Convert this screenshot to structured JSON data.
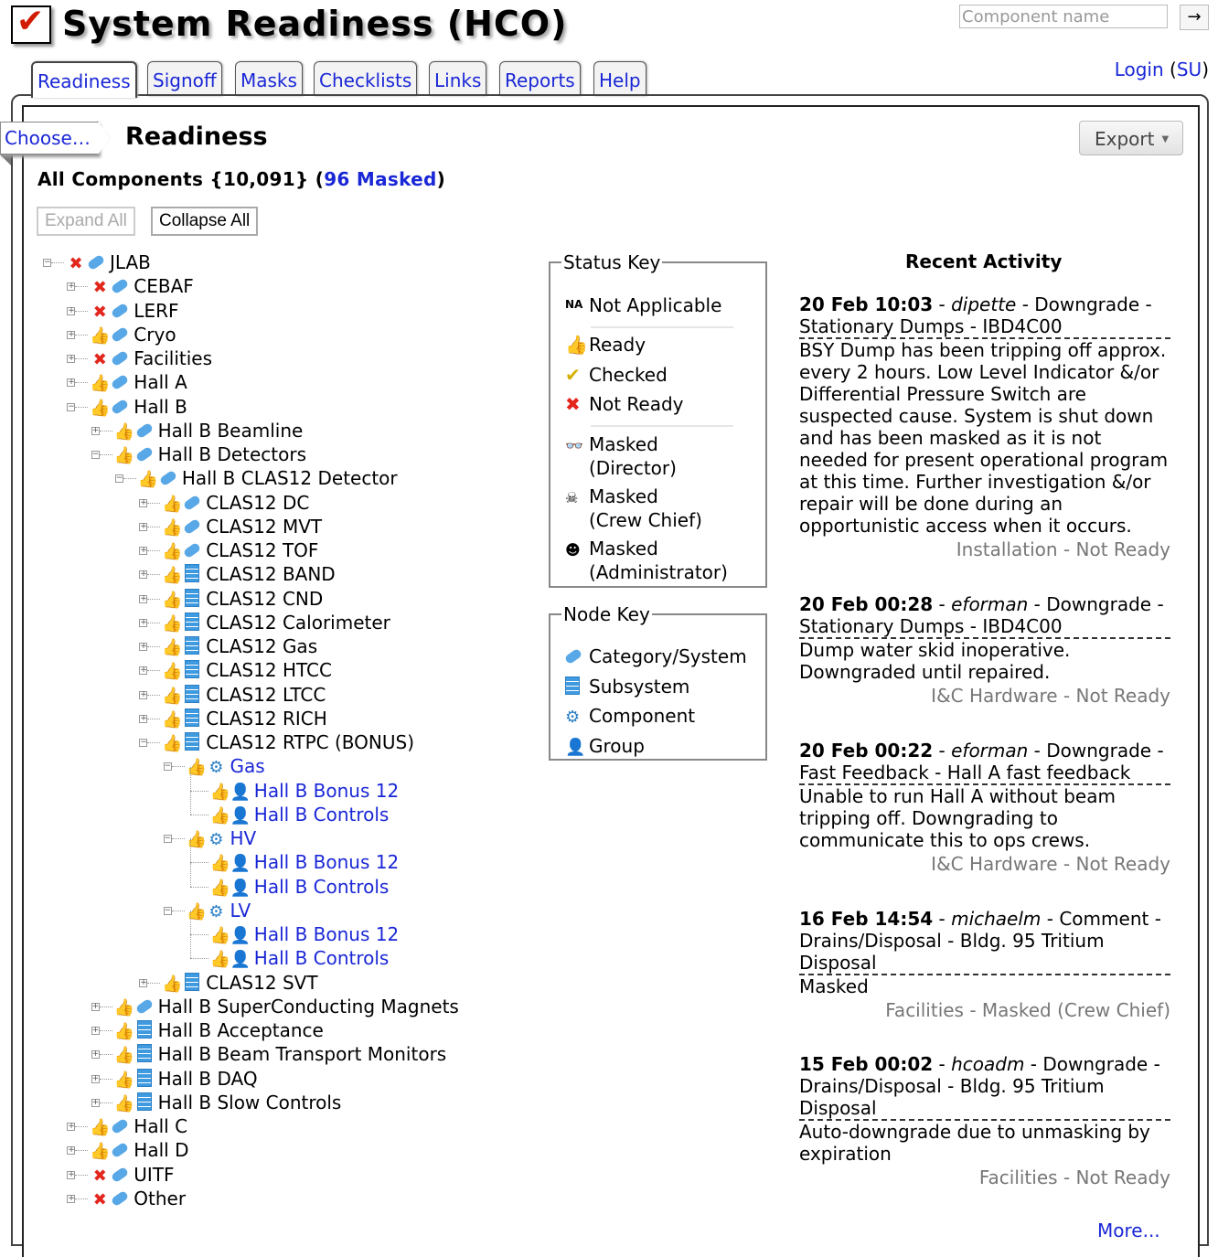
{
  "header": {
    "title": "System Readiness (HCO)",
    "search_placeholder": "Component name",
    "search_go": "→",
    "login_label": "Login",
    "su_label": "SU"
  },
  "tabs": [
    "Readiness",
    "Signoff",
    "Masks",
    "Checklists",
    "Links",
    "Reports",
    "Help"
  ],
  "page": {
    "choose_label": "Choose…",
    "title": "Readiness",
    "export_label": "Export",
    "summary_prefix": "All Components {10,091} (",
    "masked_link": "96 Masked",
    "summary_suffix": ")",
    "expand_all": "Expand All",
    "collapse_all": "Collapse All"
  },
  "tree": [
    {
      "label": "JLAB",
      "status": "notready",
      "type": "category",
      "depth": 0,
      "toggle": "-",
      "link": false
    },
    {
      "label": "CEBAF",
      "status": "notready",
      "type": "category",
      "depth": 1,
      "toggle": "+",
      "link": false
    },
    {
      "label": "LERF",
      "status": "notready",
      "type": "category",
      "depth": 1,
      "toggle": "+",
      "link": false
    },
    {
      "label": "Cryo",
      "status": "ready",
      "type": "category",
      "depth": 1,
      "toggle": "+",
      "link": false
    },
    {
      "label": "Facilities",
      "status": "notready",
      "type": "category",
      "depth": 1,
      "toggle": "+",
      "link": false
    },
    {
      "label": "Hall A",
      "status": "ready",
      "type": "category",
      "depth": 1,
      "toggle": "+",
      "link": false
    },
    {
      "label": "Hall B",
      "status": "ready",
      "type": "category",
      "depth": 1,
      "toggle": "-",
      "link": false
    },
    {
      "label": "Hall B Beamline",
      "status": "ready",
      "type": "category",
      "depth": 2,
      "toggle": "+",
      "link": false
    },
    {
      "label": "Hall B Detectors",
      "status": "ready",
      "type": "category",
      "depth": 2,
      "toggle": "-",
      "link": false
    },
    {
      "label": "Hall B CLAS12 Detector",
      "status": "ready",
      "type": "category",
      "depth": 3,
      "toggle": "-",
      "link": false
    },
    {
      "label": "CLAS12 DC",
      "status": "ready",
      "type": "category",
      "depth": 4,
      "toggle": "+",
      "link": false
    },
    {
      "label": "CLAS12 MVT",
      "status": "ready",
      "type": "category",
      "depth": 4,
      "toggle": "+",
      "link": false
    },
    {
      "label": "CLAS12 TOF",
      "status": "ready",
      "type": "category",
      "depth": 4,
      "toggle": "+",
      "link": false
    },
    {
      "label": "CLAS12 BAND",
      "status": "ready",
      "type": "subsystem",
      "depth": 4,
      "toggle": "+",
      "link": false
    },
    {
      "label": "CLAS12 CND",
      "status": "ready",
      "type": "subsystem",
      "depth": 4,
      "toggle": "+",
      "link": false
    },
    {
      "label": "CLAS12 Calorimeter",
      "status": "ready",
      "type": "subsystem",
      "depth": 4,
      "toggle": "+",
      "link": false
    },
    {
      "label": "CLAS12 Gas",
      "status": "ready",
      "type": "subsystem",
      "depth": 4,
      "toggle": "+",
      "link": false
    },
    {
      "label": "CLAS12 HTCC",
      "status": "ready",
      "type": "subsystem",
      "depth": 4,
      "toggle": "+",
      "link": false
    },
    {
      "label": "CLAS12 LTCC",
      "status": "ready",
      "type": "subsystem",
      "depth": 4,
      "toggle": "+",
      "link": false
    },
    {
      "label": "CLAS12 RICH",
      "status": "ready",
      "type": "subsystem",
      "depth": 4,
      "toggle": "+",
      "link": false
    },
    {
      "label": "CLAS12 RTPC (BONUS)",
      "status": "ready",
      "type": "subsystem",
      "depth": 4,
      "toggle": "-",
      "link": false
    },
    {
      "label": "Gas",
      "status": "ready",
      "type": "component",
      "depth": 5,
      "toggle": "-",
      "link": true
    },
    {
      "label": "Hall B Bonus 12",
      "status": "ready",
      "type": "group",
      "depth": 6,
      "toggle": "",
      "link": true
    },
    {
      "label": "Hall B Controls",
      "status": "ready",
      "type": "group",
      "depth": 6,
      "toggle": "",
      "link": true
    },
    {
      "label": "HV",
      "status": "ready",
      "type": "component",
      "depth": 5,
      "toggle": "-",
      "link": true
    },
    {
      "label": "Hall B Bonus 12",
      "status": "ready",
      "type": "group",
      "depth": 6,
      "toggle": "",
      "link": true
    },
    {
      "label": "Hall B Controls",
      "status": "ready",
      "type": "group",
      "depth": 6,
      "toggle": "",
      "link": true
    },
    {
      "label": "LV",
      "status": "ready",
      "type": "component",
      "depth": 5,
      "toggle": "-",
      "link": true
    },
    {
      "label": "Hall B Bonus 12",
      "status": "ready",
      "type": "group",
      "depth": 6,
      "toggle": "",
      "link": true
    },
    {
      "label": "Hall B Controls",
      "status": "ready",
      "type": "group",
      "depth": 6,
      "toggle": "",
      "link": true
    },
    {
      "label": "CLAS12 SVT",
      "status": "ready",
      "type": "subsystem",
      "depth": 4,
      "toggle": "+",
      "link": false
    },
    {
      "label": "Hall B SuperConducting Magnets",
      "status": "ready",
      "type": "category",
      "depth": 2,
      "toggle": "+",
      "link": false
    },
    {
      "label": "Hall B Acceptance",
      "status": "ready",
      "type": "subsystem",
      "depth": 2,
      "toggle": "+",
      "link": false
    },
    {
      "label": "Hall B Beam Transport Monitors",
      "status": "ready",
      "type": "subsystem",
      "depth": 2,
      "toggle": "+",
      "link": false
    },
    {
      "label": "Hall B DAQ",
      "status": "ready",
      "type": "subsystem",
      "depth": 2,
      "toggle": "+",
      "link": false
    },
    {
      "label": "Hall B Slow Controls",
      "status": "ready",
      "type": "subsystem",
      "depth": 2,
      "toggle": "+",
      "link": false
    },
    {
      "label": "Hall C",
      "status": "ready",
      "type": "category",
      "depth": 1,
      "toggle": "+",
      "link": false
    },
    {
      "label": "Hall D",
      "status": "ready",
      "type": "category",
      "depth": 1,
      "toggle": "+",
      "link": false
    },
    {
      "label": "UITF",
      "status": "notready",
      "type": "category",
      "depth": 1,
      "toggle": "+",
      "link": false
    },
    {
      "label": "Other",
      "status": "notready",
      "type": "category",
      "depth": 1,
      "toggle": "+",
      "link": false
    }
  ],
  "status_key": {
    "title": "Status Key",
    "not_applicable": "Not Applicable",
    "na_icon": "NA",
    "ready": "Ready",
    "checked": "Checked",
    "not_ready": "Not Ready",
    "masked_director_1": "Masked",
    "masked_director_2": "(Director)",
    "masked_crew_1": "Masked",
    "masked_crew_2": "(Crew Chief)",
    "masked_admin_1": "Masked",
    "masked_admin_2": "(Administrator)"
  },
  "node_key": {
    "title": "Node Key",
    "category": "Category/System",
    "subsystem": "Subsystem",
    "component": "Component",
    "group": "Group"
  },
  "activity": {
    "title": "Recent Activity",
    "more": "More...",
    "items": [
      {
        "date": "20 Feb 10:03",
        "user": "dipette",
        "action": "Downgrade",
        "target": "Stationary Dumps - IBD4C00",
        "comment": "BSY Dump has been tripping off approx. every 2 hours. Low Level Indicator &/or Differential Pressure Switch are suspected cause. System is shut down and has been masked as it is not needed for present operational program at this time. Further investigation &/or repair will be done during an opportunistic access when it occurs.",
        "group": "Installation",
        "status": "Not Ready"
      },
      {
        "date": "20 Feb 00:28",
        "user": "eforman",
        "action": "Downgrade",
        "target": "Stationary Dumps - IBD4C00",
        "comment": "Dump water skid inoperative. Downgraded until repaired.",
        "group": "I&C Hardware",
        "status": "Not Ready"
      },
      {
        "date": "20 Feb 00:22",
        "user": "eforman",
        "action": "Downgrade",
        "target": "Fast Feedback - Hall A fast feedback",
        "comment": "Unable to run Hall A without beam tripping off. Downgrading to communicate this to ops crews.",
        "group": "I&C Hardware",
        "status": "Not Ready"
      },
      {
        "date": "16 Feb 14:54",
        "user": "michaelm",
        "action": "Comment",
        "target": "Drains/Disposal - Bldg. 95 Tritium Disposal",
        "comment": "Masked",
        "group": "Facilities",
        "status": "Masked (Crew Chief)"
      },
      {
        "date": "15 Feb 00:02",
        "user": "hcoadm",
        "action": "Downgrade",
        "target": "Drains/Disposal - Bldg. 95 Tritium Disposal",
        "comment": "Auto-downgrade due to unmasking by expiration",
        "group": "Facilities",
        "status": "Not Ready"
      }
    ]
  }
}
